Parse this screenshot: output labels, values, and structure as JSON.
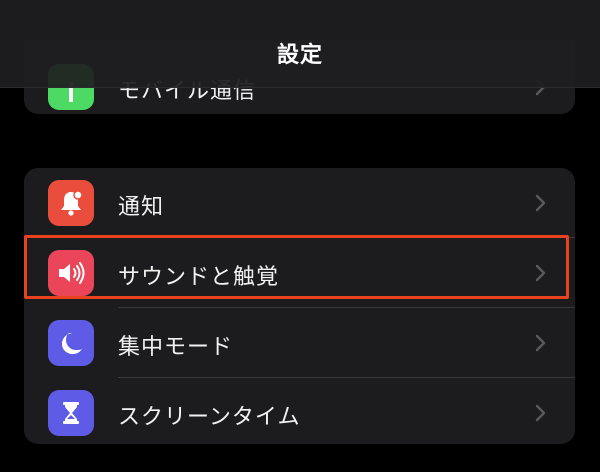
{
  "header": {
    "title": "設定"
  },
  "top_group": {
    "partial_label": "モバイル通信",
    "icon": "antenna-icon",
    "icon_color": "#4cd964"
  },
  "settings_group": {
    "items": [
      {
        "label": "通知",
        "icon": "bell-icon",
        "icon_color": "#eb4d3d"
      },
      {
        "label": "サウンドと触覚",
        "icon": "speaker-icon",
        "icon_color": "#eb4559",
        "highlighted": true
      },
      {
        "label": "集中モード",
        "icon": "moon-icon",
        "icon_color": "#5e5ce6"
      },
      {
        "label": "スクリーンタイム",
        "icon": "hourglass-icon",
        "icon_color": "#5e5ce6"
      }
    ]
  },
  "highlight_color": "#e8421f"
}
